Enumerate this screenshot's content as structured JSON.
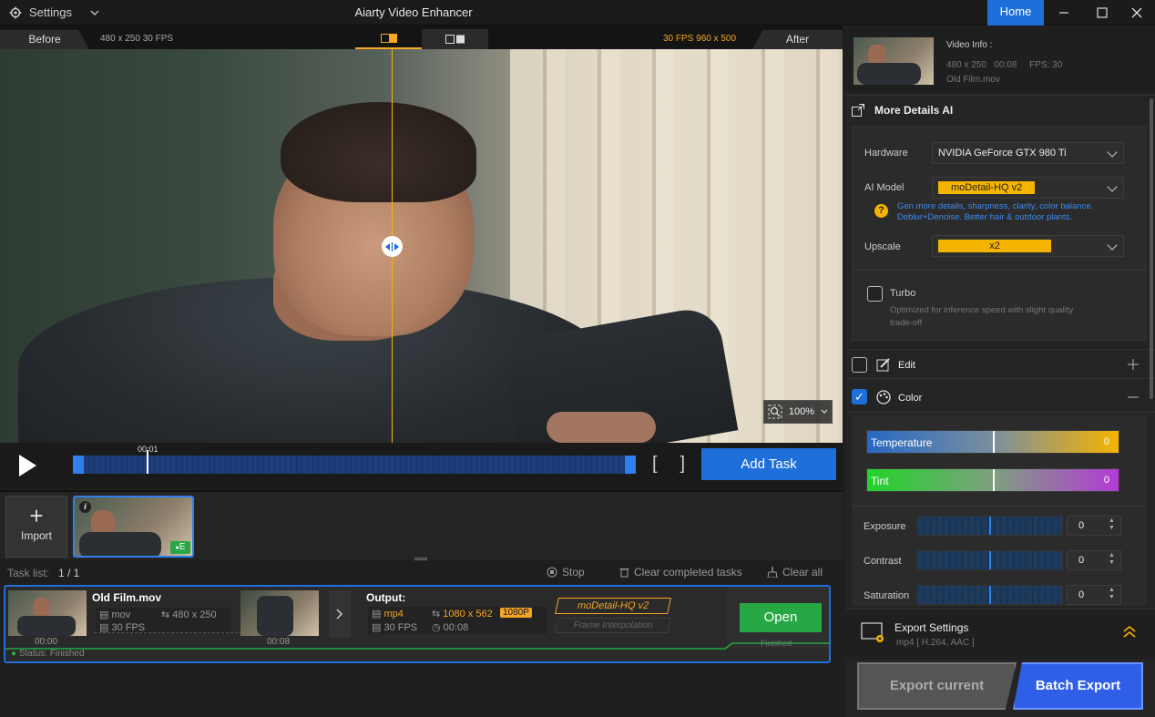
{
  "titlebar": {
    "settings_label": "Settings",
    "app_title": "Aiarty Video Enhancer",
    "home_label": "Home"
  },
  "compare_bar": {
    "before_label": "Before",
    "before_info": "480 x 250  30 FPS",
    "after_info": "30 FPS  960 x 500",
    "after_label": "After"
  },
  "preview": {
    "zoom": "100%"
  },
  "playback": {
    "time_label": "00:01",
    "add_task_label": "Add Task"
  },
  "media": {
    "import_label": "Import",
    "thumb_info_badge": "i",
    "thumb_status_badge": "E"
  },
  "task_list": {
    "label": "Task list:",
    "count": "1 / 1",
    "stop_label": "Stop",
    "clear_completed_label": "Clear completed tasks",
    "clear_all_label": "Clear all",
    "task": {
      "name": "Old Film.mov",
      "input_format": "mov",
      "input_resolution": "480 x 250",
      "input_fps": "30 FPS",
      "start_time": "00:00",
      "end_time": "00:08",
      "output_label": "Output:",
      "output_format": "mp4",
      "output_resolution": "1080 x 562",
      "output_badge": "1080P",
      "output_fps": "30 FPS",
      "output_duration": "00:08",
      "model_tag": "moDetail-HQ  v2",
      "frame_interp": "Frame Interpolation",
      "status": "Status: Finished",
      "open_label": "Open",
      "finished_label": "Finished"
    }
  },
  "right_panel": {
    "video_info": {
      "title": "Video Info :",
      "specs": "480 x 250   00:08     FPS: 30",
      "filename": "Old Film.mov"
    },
    "more_details": {
      "title": "More Details AI",
      "hardware_label": "Hardware",
      "hardware_value": "NVIDIA GeForce GTX 980 Ti",
      "ai_model_label": "AI Model",
      "ai_model_value": "moDetail-HQ  v2",
      "model_desc_1": "Gen more details, sharpness, clarity, color balance.",
      "model_desc_2": "Deblur+Denoise. Better hair & outdoor plants.",
      "upscale_label": "Upscale",
      "upscale_value": "x2",
      "turbo_label": "Turbo",
      "turbo_desc_1": "Optimized for inference speed with slight quality",
      "turbo_desc_2": "trade-off"
    },
    "edit_label": "Edit",
    "color": {
      "label": "Color",
      "temperature_label": "Temperature",
      "temperature_value": "0",
      "tint_label": "Tint",
      "tint_value": "0",
      "exposure_label": "Exposure",
      "exposure_value": "0",
      "contrast_label": "Contrast",
      "contrast_value": "0",
      "saturation_label": "Saturation",
      "saturation_value": "0"
    },
    "export_settings": {
      "title": "Export Settings",
      "subtitle": "mp4 [ H.264, AAC ]"
    },
    "export_current_label": "Export current",
    "batch_export_label": "Batch Export"
  },
  "colors": {
    "accent_blue": "#1e6fd9",
    "accent_orange": "#f5a623",
    "success_green": "#28a745"
  }
}
